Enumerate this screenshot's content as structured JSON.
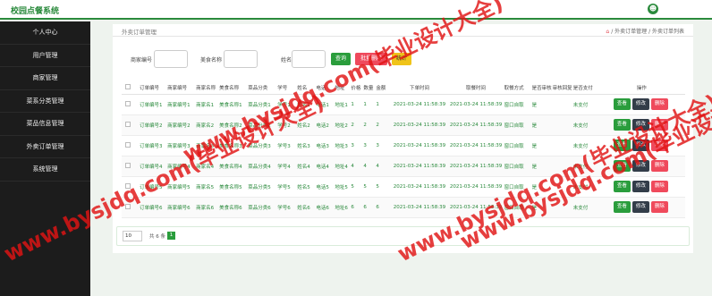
{
  "app": {
    "title": "校园点餐系统"
  },
  "sidebar": {
    "items": [
      "个人中心",
      "用户管理",
      "商家管理",
      "菜系分类管理",
      "菜品信息管理",
      "外卖订单管理",
      "系统管理"
    ]
  },
  "panel": {
    "title": "外卖订单管理",
    "breadcrumb": "/ 外卖订单管理 / 外卖订单列表"
  },
  "search": {
    "merchant_no_label": "商家编号",
    "food_name_label": "美食名称",
    "name_label": "姓名",
    "query_button": "查询",
    "batch_delete_button": "批量删除",
    "stats_button": "统计"
  },
  "table": {
    "headers": [
      "订单编号",
      "商家编号",
      "商家名称",
      "美食名称",
      "菜品分类",
      "学号",
      "姓名",
      "电话",
      "地址",
      "价格",
      "数量",
      "金额",
      "下单时间",
      "取餐时间",
      "取餐方式",
      "是否审核",
      "审核回复",
      "是否支付",
      "操作"
    ],
    "rows": [
      {
        "order_no": "订单编号1",
        "merchant_no": "商家编号1",
        "merchant_name": "商家名1",
        "food_name": "美食名称1",
        "category": "菜品分类1",
        "student_no": "学号1",
        "name": "姓名1",
        "phone": "电话1",
        "address": "地址1",
        "price": "1",
        "qty": "1",
        "amount": "1",
        "order_time": "2021-03-24 11:58:39",
        "pickup_time": "2021-03-24 11:58:39",
        "pickup_method": "窗口自取",
        "audited": "是",
        "reply": "",
        "paid": "未支付"
      },
      {
        "order_no": "订单编号2",
        "merchant_no": "商家编号2",
        "merchant_name": "商家名2",
        "food_name": "美食名称2",
        "category": "菜品分类2",
        "student_no": "学号2",
        "name": "姓名2",
        "phone": "电话2",
        "address": "地址2",
        "price": "2",
        "qty": "2",
        "amount": "2",
        "order_time": "2021-03-24 11:58:39",
        "pickup_time": "2021-03-24 11:58:39",
        "pickup_method": "窗口自取",
        "audited": "是",
        "reply": "",
        "paid": "未支付"
      },
      {
        "order_no": "订单编号3",
        "merchant_no": "商家编号3",
        "merchant_name": "商家名3",
        "food_name": "美食名称3",
        "category": "菜品分类3",
        "student_no": "学号3",
        "name": "姓名3",
        "phone": "电话3",
        "address": "地址3",
        "price": "3",
        "qty": "3",
        "amount": "3",
        "order_time": "2021-03-24 11:58:39",
        "pickup_time": "2021-03-24 11:58:39",
        "pickup_method": "窗口自取",
        "audited": "是",
        "reply": "",
        "paid": "未支付"
      },
      {
        "order_no": "订单编号4",
        "merchant_no": "商家编号4",
        "merchant_name": "商家名4",
        "food_name": "美食名称4",
        "category": "菜品分类4",
        "student_no": "学号4",
        "name": "姓名4",
        "phone": "电话4",
        "address": "地址4",
        "price": "4",
        "qty": "4",
        "amount": "4",
        "order_time": "2021-03-24 11:58:39",
        "pickup_time": "2021-03-24 11:58:39",
        "pickup_method": "窗口自取",
        "audited": "是",
        "reply": "",
        "paid": "未支付"
      },
      {
        "order_no": "订单编号5",
        "merchant_no": "商家编号5",
        "merchant_name": "商家名5",
        "food_name": "美食名称5",
        "category": "菜品分类5",
        "student_no": "学号5",
        "name": "姓名5",
        "phone": "电话5",
        "address": "地址5",
        "price": "5",
        "qty": "5",
        "amount": "5",
        "order_time": "2021-03-24 11:58:39",
        "pickup_time": "2021-03-24 11:58:39",
        "pickup_method": "窗口自取",
        "audited": "是",
        "reply": "",
        "paid": "未支付"
      },
      {
        "order_no": "订单编号6",
        "merchant_no": "商家编号6",
        "merchant_name": "商家名6",
        "food_name": "美食名称6",
        "category": "菜品分类6",
        "student_no": "学号6",
        "name": "姓名6",
        "phone": "电话6",
        "address": "地址6",
        "price": "6",
        "qty": "6",
        "amount": "6",
        "order_time": "2021-03-24 11:58:39",
        "pickup_time": "2021-03-24 11:58:39",
        "pickup_method": "窗口自取",
        "audited": "是",
        "reply": "",
        "paid": "未支付"
      }
    ],
    "actions": {
      "view": "查看",
      "edit": "修改",
      "delete": "删除"
    }
  },
  "pagination": {
    "page_size": "10",
    "total": "共 6 条",
    "current_page": "1"
  },
  "watermark": {
    "text": "www.bysjdq.com(毕业设计大全)"
  },
  "colors": {
    "accent": "#2a8a3c",
    "danger": "#ef4a5c",
    "warning": "#f0c419",
    "dark": "#333d49"
  }
}
